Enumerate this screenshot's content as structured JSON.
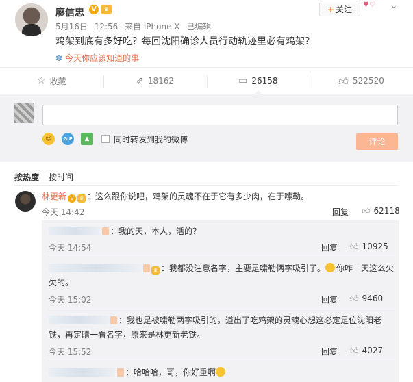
{
  "post": {
    "username": "廖信忠",
    "v_badge": "V",
    "level_badge": "♛",
    "date": "5月16日",
    "time": "12:56",
    "source": "来自 iPhone X",
    "edited": "已编辑",
    "follow_label": "关注",
    "text": "鸡架到底有多好吃？每回沈阳确诊人员行动轨迹里必有鸡架？",
    "topic": "今天你应该知道的事"
  },
  "actions": {
    "favorite": "收藏",
    "repost": "18162",
    "comment": "26158",
    "like": "522520"
  },
  "compose": {
    "placeholder": "",
    "repost_checkbox_label": "同时转发到我的微博",
    "submit_label": "评论"
  },
  "sort": {
    "by_hot": "按热度",
    "by_time": "按时间"
  },
  "top_comment": {
    "author": "林更新",
    "text": "：这么跟你说吧，鸡架的灵魂不在于它有多少肉，在于嗦勒。",
    "time": "今天 14:42",
    "reply_label": "回复",
    "likes": "62118"
  },
  "replies": [
    {
      "text": "：我的天，本人，活的？",
      "time": "今天 14:54",
      "reply_label": "回复",
      "likes": "10925"
    },
    {
      "text_1": "：我都没注意名字，主要是嗦勒俩字吸引了。",
      "text_2": "你咋一天这么欠欠的。",
      "time": "今天 15:02",
      "reply_label": "回复",
      "likes": "9460"
    },
    {
      "text": "：我也是被嗦勒两字吸引的，道出了吃鸡架的灵魂心想这必定是位沈阳老铁，再定睛一看名字，原来是林更新老铁。",
      "time": "今天 15:52",
      "reply_label": "回复",
      "likes": "4027"
    },
    {
      "text": "：哈哈哈，哥，你好重啊"
    }
  ],
  "colors": {
    "accent": "#eb7350",
    "panel_bg": "#f2f2f5",
    "submit_disabled": "#fbb793"
  }
}
